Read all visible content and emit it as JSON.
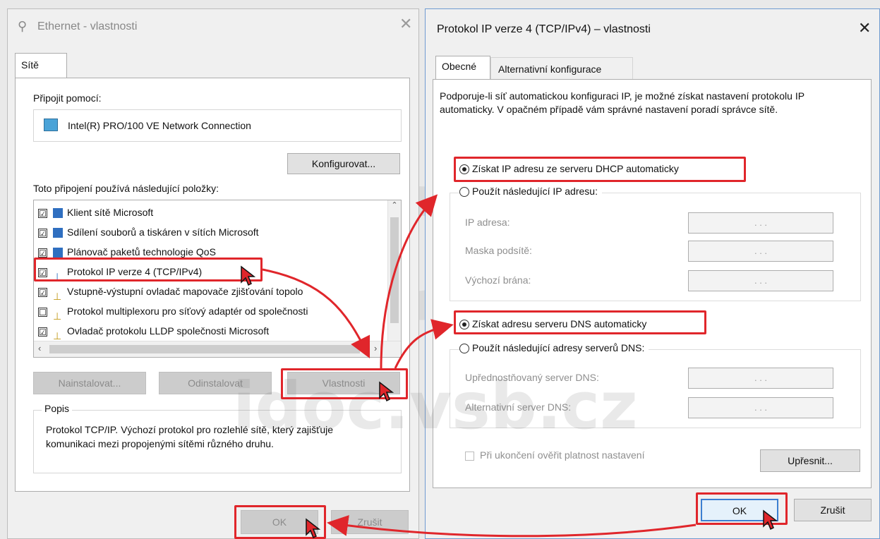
{
  "left": {
    "title": "Ethernet - vlastnosti",
    "tab_label": "Sítě",
    "connect_label": "Připojit pomocí:",
    "adapter": "Intel(R) PRO/100 VE Network Connection",
    "configure_btn": "Konfigurovat...",
    "items_label": "Toto připojení používá následující položky:",
    "items": [
      {
        "label": "Klient sítě Microsoft",
        "checked": "☑"
      },
      {
        "label": "Sdílení souborů a tiskáren v sítích Microsoft",
        "checked": "☑"
      },
      {
        "label": "Plánovač paketů technologie QoS",
        "checked": "☑"
      },
      {
        "label": "Protokol IP verze 4 (TCP/IPv4)",
        "checked": "☑"
      },
      {
        "label": "Vstupně-výstupní ovladač mapovače zjišťování topolo",
        "checked": "☑"
      },
      {
        "label": "Protokol multiplexoru pro síťový adaptér od společnosti",
        "checked": "☐"
      },
      {
        "label": "Ovladač protokolu LLDP společnosti Microsoft",
        "checked": "☑"
      }
    ],
    "install_btn": "Nainstalovat...",
    "uninstall_btn": "Odinstalovat",
    "properties_btn": "Vlastnosti",
    "description_title": "Popis",
    "description_text": "Protokol TCP/IP. Výchozí protokol pro rozlehlé sítě, který zajišťuje komunikaci mezi propojenými sítěmi různého druhu.",
    "ok_btn": "OK",
    "cancel_btn": "Zrušit"
  },
  "right": {
    "title": "Protokol IP verze 4 (TCP/IPv4) – vlastnosti",
    "tab_general": "Obecné",
    "tab_alt": "Alternativní konfigurace",
    "intro_text": "Podporuje-li síť automatickou konfiguraci IP, je možné získat nastavení protokolu IP automaticky. V opačném případě vám správné nastavení poradí správce sítě.",
    "radio_ip_auto": "Získat IP adresu ze serveru DHCP automaticky",
    "radio_ip_manual": "Použít následující IP adresu:",
    "ip_label": "IP adresa:",
    "mask_label": "Maska podsítě:",
    "gateway_label": "Výchozí brána:",
    "radio_dns_auto": "Získat adresu serveru DNS automaticky",
    "radio_dns_manual": "Použít následující adresy serverů DNS:",
    "dns_pref_label": "Upřednostňovaný server DNS:",
    "dns_alt_label": "Alternativní server DNS:",
    "ip_dots": ".       .       .",
    "validate_label": "Při ukončení ověřit platnost nastavení",
    "advanced_btn": "Upřesnit...",
    "ok_btn": "OK",
    "cancel_btn": "Zrušit",
    "close_glyph": "✕"
  },
  "watermark": {
    "big": "idoc",
    "small": "idoc.vsb.cz"
  },
  "colors": {
    "highlight": "#e0262b",
    "accent": "#3c7fd1"
  }
}
